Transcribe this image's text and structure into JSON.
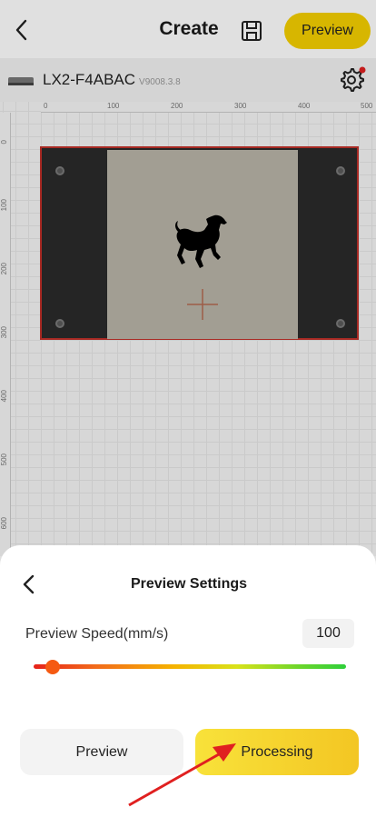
{
  "header": {
    "title": "Create",
    "preview_label": "Preview"
  },
  "device": {
    "name": "LX2-F4ABAC",
    "version": "V9008.3.8"
  },
  "ruler": {
    "top_ticks": [
      "0",
      "100",
      "200",
      "300",
      "400",
      "500"
    ],
    "left_ticks": [
      "0",
      "100",
      "200",
      "300",
      "400",
      "500",
      "600"
    ]
  },
  "preview_settings": {
    "title": "Preview Settings",
    "speed_label": "Preview Speed(mm/s)",
    "speed_value": "100",
    "speed_fraction": 0.06,
    "preview_button": "Preview",
    "processing_button": "Processing"
  },
  "colors": {
    "accent": "#f5d000",
    "work_border": "#c0302a",
    "slider_thumb": "#f55a12",
    "annotation_arrow": "#e02020"
  },
  "icons": {
    "back": "chevron-left-icon",
    "save": "save-icon",
    "settings": "gear-icon",
    "device": "laser-device-icon"
  }
}
